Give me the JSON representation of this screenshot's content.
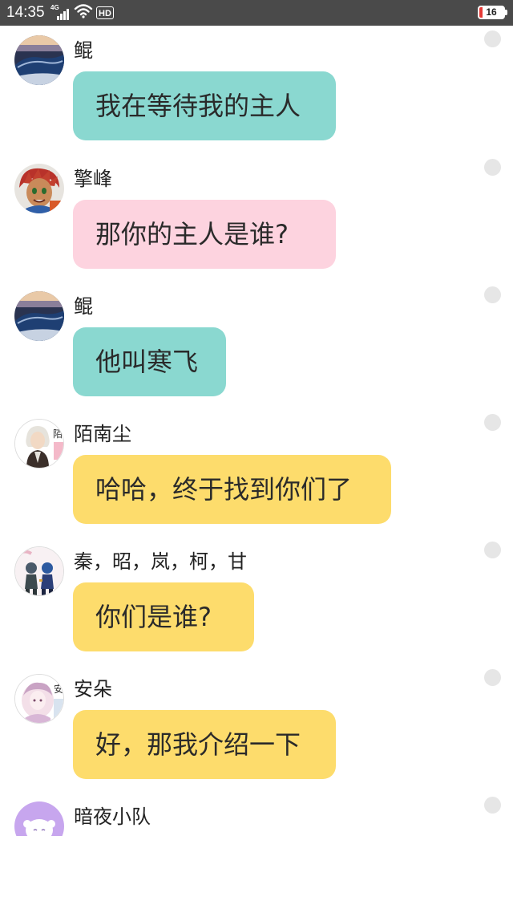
{
  "status_bar": {
    "time": "14:35",
    "network": "4G",
    "hd_label": "HD",
    "battery_level": "16"
  },
  "colors": {
    "teal_bubble": "#8ad8d0",
    "pink_bubble": "#fdd3df",
    "yellow_bubble": "#fddc6c",
    "status_bar_bg": "#4a4a4a"
  },
  "messages": [
    {
      "sender": "鲲",
      "text": "我在等待我的主人",
      "bubble_color": "teal",
      "avatar_icon": "whale-night-sky-avatar"
    },
    {
      "sender": "擎峰",
      "text": "那你的主人是谁?",
      "bubble_color": "pink",
      "avatar_icon": "cartoon-boy-avatar"
    },
    {
      "sender": "鲲",
      "text": "他叫寒飞",
      "bubble_color": "teal",
      "avatar_icon": "whale-night-sky-avatar"
    },
    {
      "sender": "陌南尘",
      "text": "哈哈，终于找到你们了",
      "bubble_color": "yellow",
      "avatar_icon": "white-hair-character-avatar",
      "avatar_text": "陌"
    },
    {
      "sender": "秦，昭，岚，柯，甘",
      "text": "你们是谁?",
      "bubble_color": "yellow",
      "avatar_icon": "group-characters-avatar"
    },
    {
      "sender": "安朵",
      "text": "好，那我介绍一下",
      "bubble_color": "yellow",
      "avatar_icon": "pink-girl-avatar",
      "avatar_text": "安"
    },
    {
      "sender": "暗夜小队",
      "avatar_icon": "purple-face-avatar"
    }
  ]
}
